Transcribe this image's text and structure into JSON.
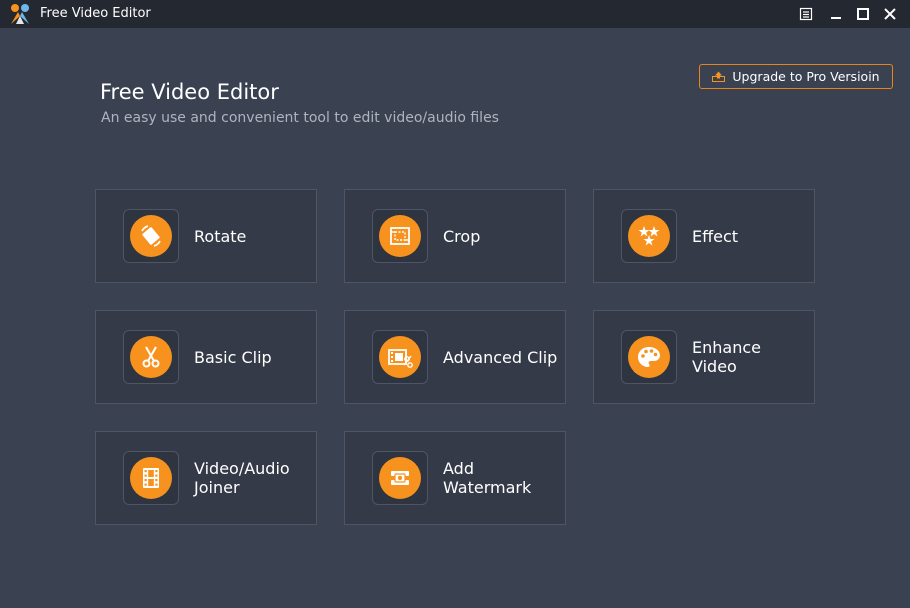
{
  "window": {
    "title": "Free Video Editor",
    "controls": {
      "menu_icon": "menu-icon",
      "minimize_icon": "minimize-icon",
      "maximize_icon": "maximize-icon",
      "close_icon": "close-icon"
    }
  },
  "header": {
    "title": "Free Video Editor",
    "subtitle": "An easy use and convenient tool to edit video/audio files",
    "upgrade_label": "Upgrade to Pro Versioin",
    "upgrade_icon": "upgrade-icon"
  },
  "tools": [
    {
      "label": "Rotate",
      "icon": "rotate-icon"
    },
    {
      "label": "Crop",
      "icon": "crop-icon"
    },
    {
      "label": "Effect",
      "icon": "effect-stars-icon"
    },
    {
      "label": "Basic Clip",
      "icon": "scissors-icon"
    },
    {
      "label": "Advanced Clip",
      "icon": "advanced-clip-icon"
    },
    {
      "label": "Enhance Video",
      "icon": "palette-icon"
    },
    {
      "label": "Video/Audio Joiner",
      "icon": "film-strip-icon"
    },
    {
      "label": "Add Watermark",
      "icon": "watermark-icon"
    }
  ],
  "colors": {
    "background": "#3a4150",
    "titlebar": "#232831",
    "tile": "#343a48",
    "tile_border": "#4e5567",
    "accent": "#f7921e",
    "upgrade_border": "#e8841d"
  }
}
